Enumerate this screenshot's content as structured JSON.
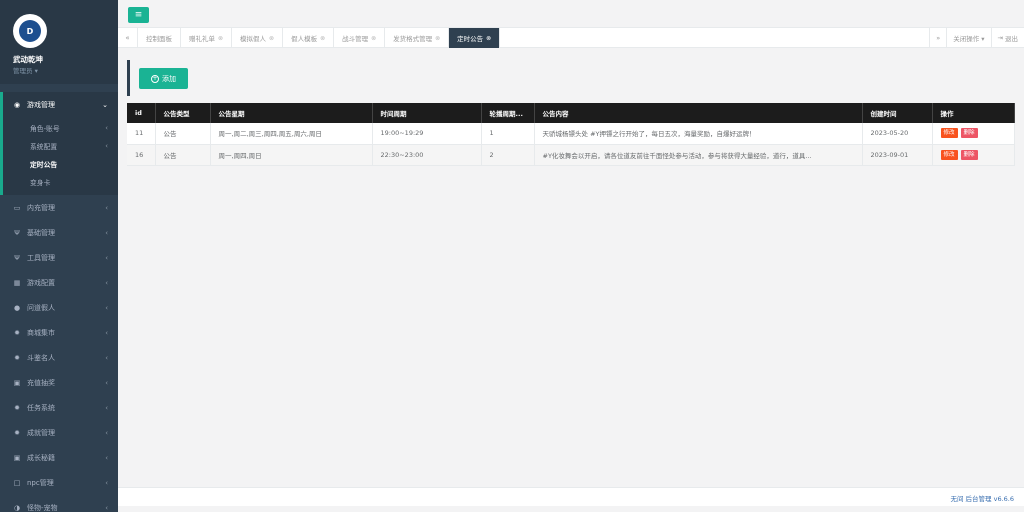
{
  "profile": {
    "name": "武动乾坤",
    "role": "管理员 ▾",
    "logo_text": "D"
  },
  "menu": {
    "active_group": {
      "label": "游戏管理",
      "icon": "gamepad-icon"
    },
    "submenu": [
      {
        "label": "角色-账号",
        "has_arrow": true
      },
      {
        "label": "系统配置",
        "has_arrow": true
      },
      {
        "label": "定时公告",
        "current": true
      },
      {
        "label": "变身卡"
      }
    ],
    "items": [
      {
        "label": "内充管理",
        "icon": "monitor-icon"
      },
      {
        "label": "基础管理",
        "icon": "fork-icon"
      },
      {
        "label": "工具管理",
        "icon": "fork-icon"
      },
      {
        "label": "游戏配置",
        "icon": "grid-icon"
      },
      {
        "label": "问道假人",
        "icon": "user-icon"
      },
      {
        "label": "商城集市",
        "icon": "gear-icon"
      },
      {
        "label": "斗鉴名人",
        "icon": "gear-icon"
      },
      {
        "label": "充值抽奖",
        "icon": "card-icon"
      },
      {
        "label": "任务系统",
        "icon": "gear-icon"
      },
      {
        "label": "成就管理",
        "icon": "gear-icon"
      },
      {
        "label": "成长秘籍",
        "icon": "card-icon"
      },
      {
        "label": "npc管理",
        "icon": "square-icon"
      },
      {
        "label": "怪物-宠物",
        "icon": "half-circle-icon"
      }
    ]
  },
  "tabs": [
    {
      "label": "控制面板",
      "closable": false
    },
    {
      "label": "赠礼礼单",
      "closable": true
    },
    {
      "label": "模拟假人",
      "closable": true
    },
    {
      "label": "假人模板",
      "closable": true
    },
    {
      "label": "战斗管理",
      "closable": true
    },
    {
      "label": "发货格式管理",
      "closable": true
    },
    {
      "label": "定时公告",
      "closable": true,
      "active": true
    }
  ],
  "tab_actions": {
    "close_ops": "关闭操作 ▾",
    "logout": "退出"
  },
  "toolbar": {
    "add_label": "添加"
  },
  "table": {
    "headers": [
      "id",
      "公告类型",
      "公告星期",
      "时间周期",
      "轮播周期...",
      "公告内容",
      "创建时间",
      "操作"
    ],
    "rows": [
      {
        "id": "11",
        "type": "公告",
        "weekday": "周一,周二,周三,周四,周五,周六,周日",
        "period": "19:00~19:29",
        "cycle": "1",
        "content": "天骄城杨镖头处 #Y押镖之行开始了，每日五次，海量奖励，自爆好运牌！",
        "created": "2023-05-20"
      },
      {
        "id": "16",
        "type": "公告",
        "weekday": "周一,周四,周日",
        "period": "22:30~23:00",
        "cycle": "2",
        "content": "#Y化妆舞会以开启，请各位道友前往千面怪处参与活动，参与将获得大量经验，道行，道具...",
        "created": "2023-09-01"
      }
    ],
    "edit_label": "修改",
    "delete_label": "删除"
  },
  "footer": {
    "text": "无间 后台管理 v6.6.6"
  },
  "colors": {
    "accent": "#1ab394",
    "sidebar": "#2f4050",
    "danger": "#ed5565"
  }
}
